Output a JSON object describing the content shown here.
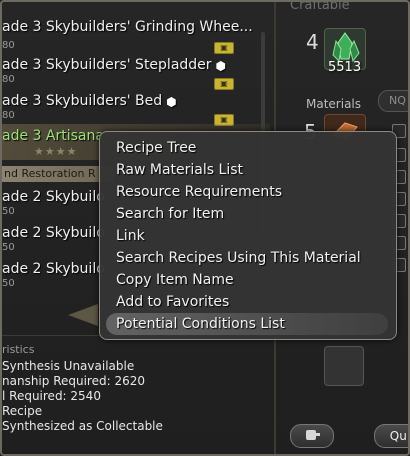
{
  "right_panel": {
    "craftable_label": "Craftable",
    "crystal_owned": "4",
    "crystal_count": "5513",
    "materials_label": "Materials",
    "nq_label": "NQ",
    "material_owned": "5",
    "quick_button_label": "Qui"
  },
  "recipes": [
    {
      "name": "ade 3 Skybuilders' Grinding Whee...",
      "sub": "80"
    },
    {
      "name": "ade 3 Skybuilders' Stepladder",
      "sub": "80"
    },
    {
      "name": "ade 3 Skybuilders' Bed",
      "sub": "80"
    },
    {
      "name": "ade 3 Artisana",
      "stars": "★★★★"
    },
    {
      "name": "ade 2 Skybuilo",
      "sub": "50"
    },
    {
      "name": "ade 2 Skybuilo",
      "sub": "50"
    },
    {
      "name": "ade 2 Skybuilo",
      "sub": "50"
    }
  ],
  "section_label": "nd Restoration R",
  "characteristics": {
    "title": "ristics",
    "lines": [
      "Synthesis Unavailable",
      "nanship Required: 2620",
      "l Required: 2540",
      "Recipe",
      "Synthesized as Collectable"
    ]
  },
  "context_menu": {
    "items": [
      "Recipe Tree",
      "Raw Materials List",
      "Resource Requirements",
      "Search for Item",
      "Link",
      "Search Recipes Using This Material",
      "Copy Item Name",
      "Add to Favorites",
      "Potential Conditions List"
    ],
    "hovered_index": 8
  }
}
